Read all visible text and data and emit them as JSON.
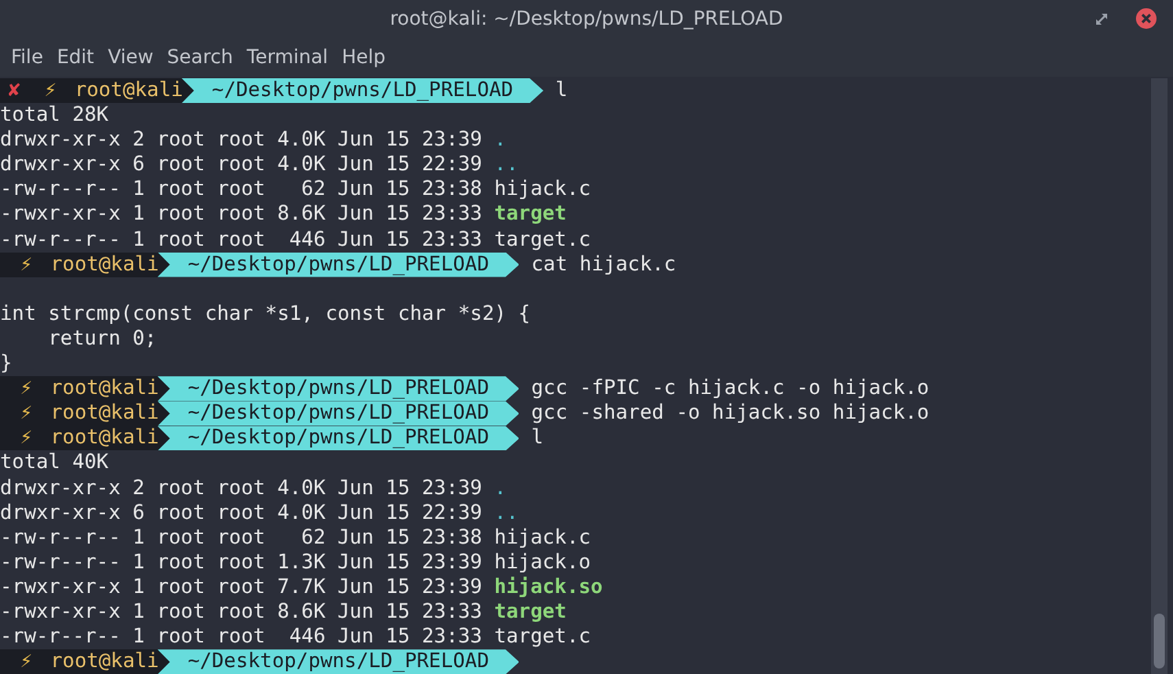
{
  "window": {
    "title": "root@kali: ~/Desktop/pwns/LD_PRELOAD"
  },
  "menu": [
    "File",
    "Edit",
    "View",
    "Search",
    "Terminal",
    "Help"
  ],
  "lines": [
    {
      "kind": "prompt",
      "marks": [
        {
          "text": "✘",
          "kind": "error"
        },
        {
          "text": "⚡",
          "kind": "root"
        }
      ],
      "user": "root@kali",
      "path": "~/Desktop/pwns/LD_PRELOAD",
      "command": "l"
    },
    {
      "kind": "text",
      "text": "total 28K"
    },
    {
      "kind": "dir",
      "info": "drwxr-xr-x 2 root root 4.0K Jun 15 23:39",
      "name": "."
    },
    {
      "kind": "dir",
      "info": "drwxr-xr-x 6 root root 4.0K Jun 15 22:39",
      "name": ".."
    },
    {
      "kind": "file",
      "info": "-rw-r--r-- 1 root root   62 Jun 15 23:38",
      "name": "hijack.c"
    },
    {
      "kind": "exec",
      "info": "-rwxr-xr-x 1 root root 8.6K Jun 15 23:33",
      "name": "target"
    },
    {
      "kind": "file",
      "info": "-rw-r--r-- 1 root root  446 Jun 15 23:33",
      "name": "target.c"
    },
    {
      "kind": "prompt",
      "marks": [
        {
          "text": "⚡",
          "kind": "root"
        }
      ],
      "user": "root@kali",
      "path": "~/Desktop/pwns/LD_PRELOAD",
      "command": "cat hijack.c"
    },
    {
      "kind": "blank"
    },
    {
      "kind": "text",
      "text": "int strcmp(const char *s1, const char *s2) {"
    },
    {
      "kind": "text",
      "text": "    return 0;"
    },
    {
      "kind": "text",
      "text": "}"
    },
    {
      "kind": "prompt",
      "marks": [
        {
          "text": "⚡",
          "kind": "root"
        }
      ],
      "user": "root@kali",
      "path": "~/Desktop/pwns/LD_PRELOAD",
      "command": "gcc -fPIC -c hijack.c -o hijack.o"
    },
    {
      "kind": "prompt",
      "marks": [
        {
          "text": "⚡",
          "kind": "root"
        }
      ],
      "user": "root@kali",
      "path": "~/Desktop/pwns/LD_PRELOAD",
      "command": "gcc -shared -o hijack.so hijack.o"
    },
    {
      "kind": "prompt",
      "marks": [
        {
          "text": "⚡",
          "kind": "root"
        }
      ],
      "user": "root@kali",
      "path": "~/Desktop/pwns/LD_PRELOAD",
      "command": "l"
    },
    {
      "kind": "text",
      "text": "total 40K"
    },
    {
      "kind": "dir",
      "info": "drwxr-xr-x 2 root root 4.0K Jun 15 23:39",
      "name": "."
    },
    {
      "kind": "dir",
      "info": "drwxr-xr-x 6 root root 4.0K Jun 15 22:39",
      "name": ".."
    },
    {
      "kind": "file",
      "info": "-rw-r--r-- 1 root root   62 Jun 15 23:38",
      "name": "hijack.c"
    },
    {
      "kind": "file",
      "info": "-rw-r--r-- 1 root root 1.3K Jun 15 23:39",
      "name": "hijack.o"
    },
    {
      "kind": "exec",
      "info": "-rwxr-xr-x 1 root root 7.7K Jun 15 23:39",
      "name": "hijack.so"
    },
    {
      "kind": "exec",
      "info": "-rwxr-xr-x 1 root root 8.6K Jun 15 23:33",
      "name": "target"
    },
    {
      "kind": "file",
      "info": "-rw-r--r-- 1 root root  446 Jun 15 23:33",
      "name": "target.c"
    },
    {
      "kind": "prompt",
      "marks": [
        {
          "text": "⚡",
          "kind": "root"
        }
      ],
      "user": "root@kali",
      "path": "~/Desktop/pwns/LD_PRELOAD"
    }
  ]
}
